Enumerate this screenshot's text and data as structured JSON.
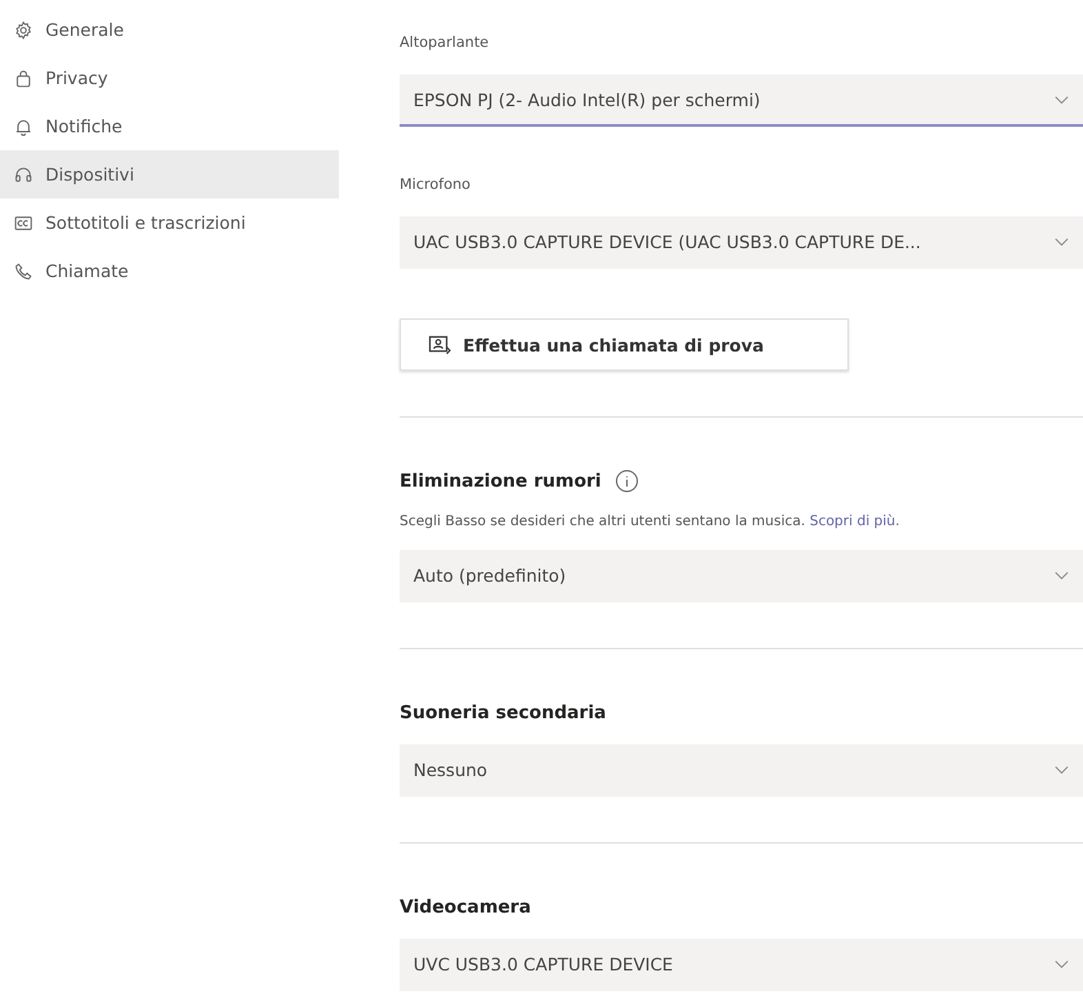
{
  "sidebar": {
    "items": [
      {
        "label": "Generale",
        "kind": "gear",
        "selected": false
      },
      {
        "label": "Privacy",
        "kind": "lock",
        "selected": false
      },
      {
        "label": "Notifiche",
        "kind": "bell",
        "selected": false
      },
      {
        "label": "Dispositivi",
        "kind": "headset",
        "selected": true
      },
      {
        "label": "Sottotitoli e trascrizioni",
        "kind": "cc",
        "selected": false
      },
      {
        "label": "Chiamate",
        "kind": "phone",
        "selected": false
      }
    ]
  },
  "sections": [
    {
      "kind": "fields",
      "fields": [
        {
          "label": "Altoparlante",
          "value": "EPSON PJ (2- Audio Intel(R) per schermi)",
          "focused": true
        },
        {
          "label": "Microfono",
          "value": "UAC USB3.0 CAPTURE DEVICE (UAC USB3.0 CAPTURE DE...",
          "focused": false
        }
      ],
      "button": "Effettua una chiamata di prova"
    },
    {
      "kind": "heading",
      "title": "Eliminazione rumori",
      "info": true,
      "description": "Scegli Basso se desideri che altri utenti sentano la musica.",
      "link": "Scopri di più.",
      "value": "Auto (predefinito)",
      "focused": false
    },
    {
      "kind": "heading",
      "title": "Suoneria secondaria",
      "info": false,
      "value": "Nessuno",
      "focused": false
    },
    {
      "kind": "heading",
      "title": "Videocamera",
      "info": false,
      "value": "UVC USB3.0 CAPTURE DEVICE",
      "focused": false
    }
  ]
}
